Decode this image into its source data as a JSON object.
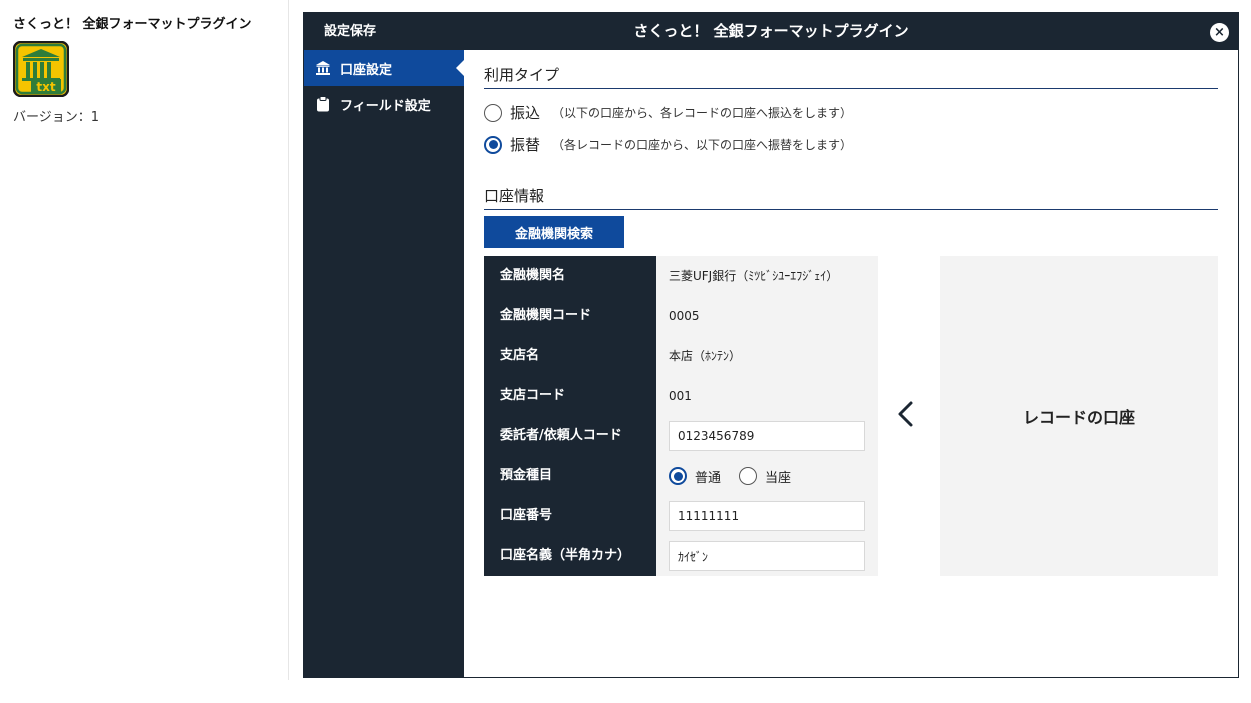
{
  "plugin": {
    "title": "さくっと！ 全銀フォーマットプラグイン",
    "version": "バージョン：1",
    "icon": "bank-txt-icon"
  },
  "dialog": {
    "save_label": "設定保存",
    "title": "さくっと！ 全銀フォーマットプラグイン",
    "close_label": "×"
  },
  "sidebar": {
    "items": [
      {
        "label": "口座設定",
        "icon": "bank-icon",
        "active": true
      },
      {
        "label": "フィールド設定",
        "icon": "clipboard-icon",
        "active": false
      }
    ]
  },
  "usage": {
    "title": "利用タイプ",
    "options": [
      {
        "label": "振込",
        "desc": "（以下の口座から、各レコードの口座へ振込をします）",
        "checked": false
      },
      {
        "label": "振替",
        "desc": "（各レコードの口座から、以下の口座へ振替をします）",
        "checked": true
      }
    ]
  },
  "account": {
    "title": "口座情報",
    "search_button": "金融機関検索",
    "rows": {
      "bank_name": {
        "label": "金融機関名",
        "value": "三菱UFJ銀行（ﾐﾂﾋﾞｼﾕｰｴﾌｼﾞｪｲ）"
      },
      "bank_code": {
        "label": "金融機関コード",
        "value": "0005"
      },
      "branch_name": {
        "label": "支店名",
        "value": "本店（ﾎﾝﾃﾝ）"
      },
      "branch_code": {
        "label": "支店コード",
        "value": "001"
      },
      "consignor_code": {
        "label": "委託者/依頼人コード",
        "value": "0123456789"
      },
      "deposit_type": {
        "label": "預金種目",
        "options": [
          "普通",
          "当座"
        ],
        "selected": "普通"
      },
      "account_number": {
        "label": "口座番号",
        "value": "11111111"
      },
      "account_name": {
        "label": "口座名義（半角カナ）",
        "value": "ｶｲｾﾞﾝ"
      }
    },
    "arrow_icon": "chevron-left-icon",
    "record_label": "レコードの口座"
  },
  "colors": {
    "dark": "#1b2632",
    "accent": "#0f4a9c",
    "panel": "#f3f3f3",
    "icon_yellow": "#f5c400"
  }
}
